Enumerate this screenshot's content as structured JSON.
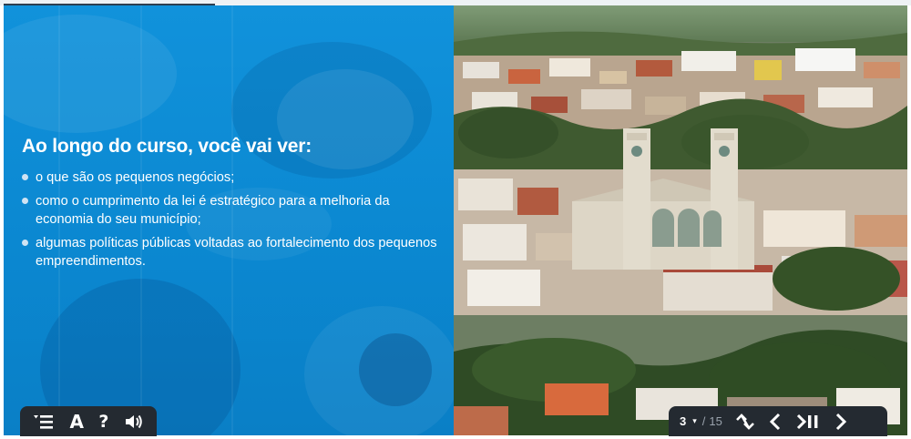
{
  "slide": {
    "heading": "Ao longo do curso, você vai ver:",
    "bullets": [
      "o que são os pequenos negócios;",
      "como o cumprimento da lei é estratégico para a melhoria da economia do seu município;",
      "algumas políticas públicas voltadas ao fortalecimento dos pequenos empreendimentos."
    ]
  },
  "player": {
    "left_controls": [
      "menu-icon",
      "font-size-icon",
      "help-icon",
      "volume-icon"
    ],
    "font_label": "A",
    "help_label": "?",
    "current_page": "3",
    "page_caret": "▾",
    "page_separator": "/",
    "total_pages": "15",
    "right_controls": [
      "collapse-icon",
      "previous-icon",
      "play-pause-icon",
      "next-icon"
    ]
  },
  "colors": {
    "panel_blue": "#0b8ad2",
    "bar_dark": "#242a31",
    "text_white": "#ffffff"
  }
}
